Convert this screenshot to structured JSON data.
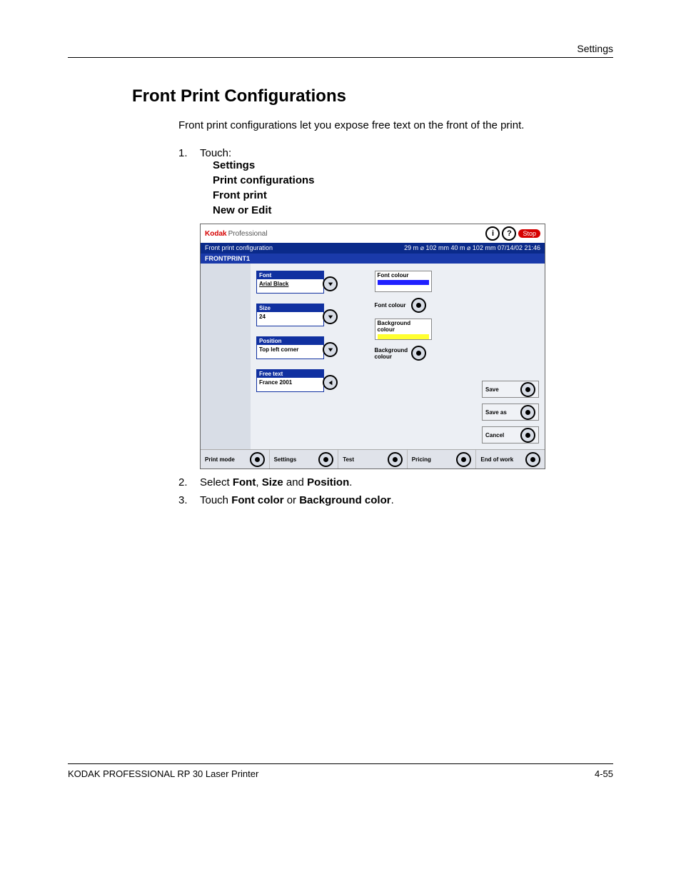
{
  "header": {
    "section": "Settings"
  },
  "title": "Front Print Configurations",
  "intro": "Front print configurations let you expose free text on the front of the print.",
  "steps": {
    "s1": {
      "num": "1.",
      "text": "Touch:"
    },
    "s1_subs": [
      "Settings",
      "Print configurations",
      "Front print",
      "New or Edit"
    ],
    "s2": {
      "num": "2.",
      "pre": "Select ",
      "b1": "Font",
      "mid1": ", ",
      "b2": "Size",
      "mid2": " and ",
      "b3": "Position",
      "post": "."
    },
    "s3": {
      "num": "3.",
      "pre": "Touch ",
      "b1": "Font color",
      "mid": " or ",
      "b2": "Background color",
      "post": "."
    }
  },
  "screenshot": {
    "brand1": "Kodak",
    "brand2": "Professional",
    "stop": "Stop",
    "bar_left": "Front print configuration",
    "bar_right": "29 m ⌀ 102 mm   40 m ⌀ 102 mm 07/14/02      21:46",
    "bar2": "FRONTPRINT1",
    "fields": {
      "font": {
        "label": "Font",
        "value": "Arial Black"
      },
      "size": {
        "label": "Size",
        "value": "24"
      },
      "position": {
        "label": "Position",
        "value": "Top left corner"
      },
      "freetext": {
        "label": "Free text",
        "value": "France 2001"
      }
    },
    "colours": {
      "fontcolour_box": "Font colour",
      "fontcolour_btn": "Font colour",
      "bgcolour_box": "Background colour",
      "bgcolour_btn": "Background colour"
    },
    "rbtns": {
      "save": "Save",
      "saveas": "Save as",
      "cancel": "Cancel"
    },
    "footer": [
      "Print mode",
      "Settings",
      "Test",
      "Pricing",
      "End of work"
    ]
  },
  "footer": {
    "left": "KODAK PROFESSIONAL RP 30 Laser Printer",
    "right": "4-55"
  }
}
